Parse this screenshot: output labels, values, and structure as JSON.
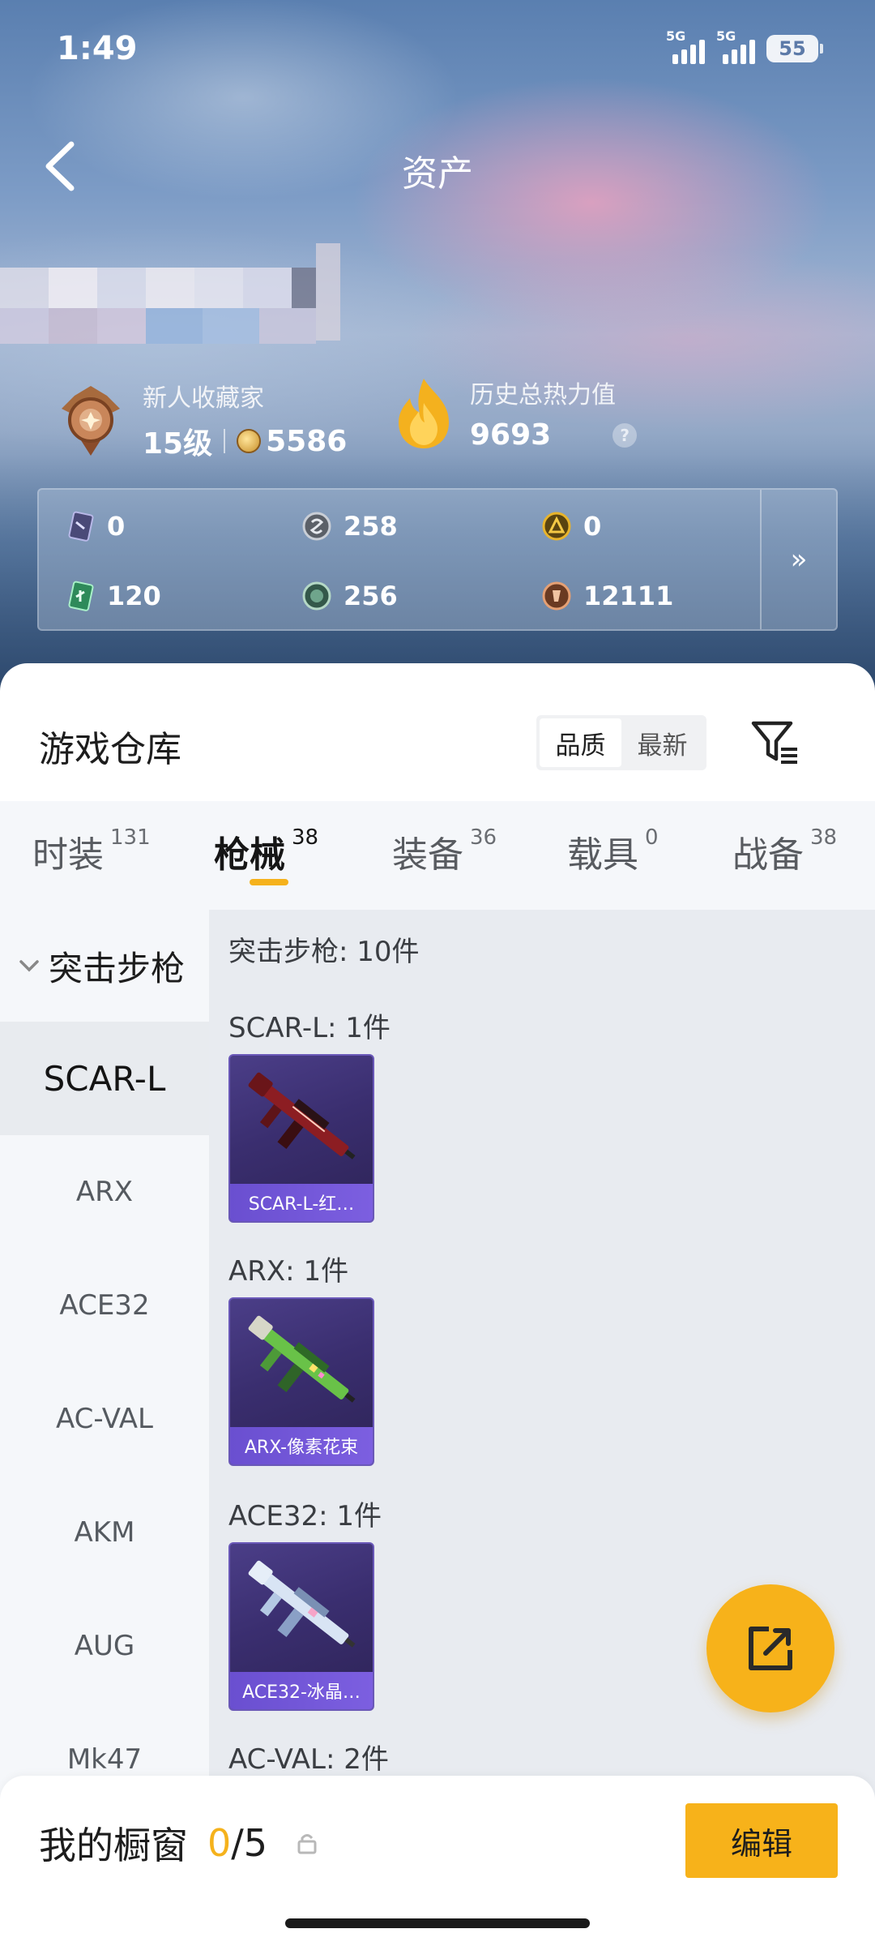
{
  "status_bar": {
    "time": "1:49",
    "network1": "5G",
    "network2": "5G",
    "battery": "55"
  },
  "header": {
    "title": "资产"
  },
  "profile": {
    "level_title": "新人收藏家",
    "level": "15级",
    "coins": "5586",
    "heat_label": "历史总热力值",
    "heat_value": "9693",
    "help": "?"
  },
  "currencies": [
    {
      "icon": "card-ticket-icon",
      "value": "0"
    },
    {
      "icon": "silver-coin-icon",
      "value": "258"
    },
    {
      "icon": "gold-emblem-icon",
      "value": "0"
    },
    {
      "icon": "green-ticket-icon",
      "value": "120"
    },
    {
      "icon": "green-coin-icon",
      "value": "256"
    },
    {
      "icon": "bronze-coin-icon",
      "value": "12111"
    }
  ],
  "currency_more": "»",
  "warehouse": {
    "title": "游戏仓库",
    "sort_options": [
      "品质",
      "最新"
    ],
    "sort_active": "品质"
  },
  "tabs": [
    {
      "label": "时装",
      "count": "131"
    },
    {
      "label": "枪械",
      "count": "38",
      "active": true
    },
    {
      "label": "装备",
      "count": "36"
    },
    {
      "label": "载具",
      "count": "0"
    },
    {
      "label": "战备",
      "count": "38"
    }
  ],
  "category": {
    "title": "突击步枪",
    "items": [
      "SCAR-L",
      "ARX",
      "ACE32",
      "AC-VAL",
      "AKM",
      "AUG",
      "Mk47"
    ],
    "active": "SCAR-L"
  },
  "content": {
    "summary": "突击步枪: 10件",
    "groups": [
      {
        "label": "SCAR-L: 1件",
        "card_name": "SCAR-L-红…",
        "theme": "red"
      },
      {
        "label": "ARX: 1件",
        "card_name": "ARX-像素花束",
        "theme": "green"
      },
      {
        "label": "ACE32: 1件",
        "card_name": "ACE32-冰晶…",
        "theme": "blue"
      },
      {
        "label": "AC-VAL: 2件"
      }
    ]
  },
  "showcase": {
    "label": "我的橱窗",
    "current": "0",
    "total": "/5",
    "edit": "编辑"
  },
  "colors": {
    "accent": "#f7b21a",
    "card_bg": "#3a2e6f",
    "card_name_bg": "#7c5fe0"
  }
}
